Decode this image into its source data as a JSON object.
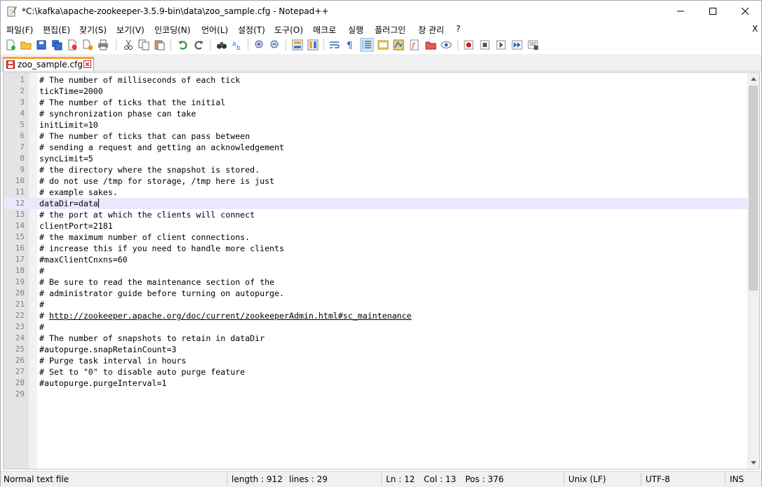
{
  "window": {
    "title": "*C:\\kafka\\apache-zookeeper-3.5.9-bin\\data\\zoo_sample.cfg - Notepad++",
    "menu_close": "X"
  },
  "menu": [
    "파일(F)",
    "편집(E)",
    "찾기(S)",
    "보기(V)",
    "인코딩(N)",
    "언어(L)",
    "설정(T)",
    "도구(O)",
    "매크로",
    "실행",
    "플러그인",
    "창 관리",
    "?"
  ],
  "tab": {
    "label": "zoo_sample.cfg"
  },
  "editor": {
    "current_line": 12,
    "lines": [
      "# The number of milliseconds of each tick",
      "tickTime=2000",
      "# The number of ticks that the initial",
      "# synchronization phase can take",
      "initLimit=10",
      "# The number of ticks that can pass between",
      "# sending a request and getting an acknowledgement",
      "syncLimit=5",
      "# the directory where the snapshot is stored.",
      "# do not use /tmp for storage, /tmp here is just",
      "# example sakes.",
      "dataDir=data",
      "# the port at which the clients will connect",
      "clientPort=2181",
      "# the maximum number of client connections.",
      "# increase this if you need to handle more clients",
      "#maxClientCnxns=60",
      "#",
      "# Be sure to read the maintenance section of the",
      "# administrator guide before turning on autopurge.",
      "#",
      "# http://zookeeper.apache.org/doc/current/zookeeperAdmin.html#sc_maintenance",
      "#",
      "# The number of snapshots to retain in dataDir",
      "#autopurge.snapRetainCount=3",
      "# Purge task interval in hours",
      "# Set to \"0\" to disable auto purge feature",
      "#autopurge.purgeInterval=1",
      ""
    ],
    "link_text": "http://zookeeper.apache.org/doc/current/zookeeperAdmin.html#sc_maintenance"
  },
  "status": {
    "file_type": "Normal text file",
    "length": "length : 912",
    "lines": "lines : 29",
    "ln": "Ln : 12",
    "col": "Col : 13",
    "pos": "Pos : 376",
    "eol": "Unix (LF)",
    "encoding": "UTF-8",
    "mode": "INS"
  },
  "colors": {
    "current_line_bg": "#e8e8ff",
    "tab_accent": "#fba22b",
    "gutter_bg": "#e4e4e4",
    "line_number": "#808080"
  }
}
